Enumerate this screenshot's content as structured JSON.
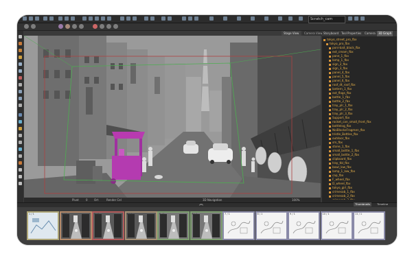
{
  "camera_select": "Scratch_cam",
  "viewport_tabs": [
    "Stage View",
    "Camera View"
  ],
  "right_tabs": [
    "Storyboard",
    "Tool Properties",
    "Camera",
    "3D Graph"
  ],
  "right_active_tab": "3D Graph",
  "scene_tree": [
    "tokyo_street_pro_fbx",
    "tokyo_pro_fbx",
    "poni-bait_black_fbx",
    "ext_cream_fbx",
    "pane_1_fbx",
    "lamp_1_fbx",
    "sign_2_fbx",
    "sign_3_fbx",
    "panel_4_fbx",
    "panel_5_fbx",
    "panel_6_fbx",
    "roof_dt_roof_fbx",
    "lantern_1_fbx",
    "ext_flags_fbx",
    "bottle_1_fbx",
    "bottle_2_fbx",
    "tray_plr_1_fbx",
    "tray_plr_2_fbx",
    "tray_plr_3_fbx",
    "Support_fbx",
    "rocket_can_small_front_fbx",
    "bottlelog_fbx",
    "NoiBlocksFragmen_fbx",
    "tristle_Bottles_fbx",
    "outdoor_fbx",
    "sm_fbx",
    "stone_1_fbx",
    "small_bottle_1_fbx",
    "small_bottle_2_fbx",
    "clipboard_fbx",
    "tray_tbl_fbx",
    "bowl_low_fbx",
    "lamp_1_low_fbx",
    "cap_fbx",
    "F_wheel_fbx",
    "D_wheel_fbx",
    "tokyo_girl_fbx",
    "crimesab_1_fbx",
    "crimesab_2_fbx",
    "crimesab_3_fbx",
    "crimesab_4_fbx",
    "crimesab_5_fbx",
    "Camera_fbx",
    "spot_fbx",
    "Scratch_Cam_fbx"
  ],
  "scene_tree_selected": "Camera_fbx",
  "status_bar": [
    "Pivot",
    "0",
    "Ort",
    "Render Cel",
    "3D Navigation",
    "100%"
  ],
  "bottom_tabs": [
    "Thumbnails",
    "Timeline"
  ],
  "bottom_active_tab": "Thumbnails",
  "thumbnails": [
    {
      "label": "1 / 1",
      "frame": "#b0a878",
      "kind": "sketch-blue"
    },
    {
      "label": "2 / 1",
      "frame": "#b48a6a",
      "kind": "street"
    },
    {
      "label": "3 / 1",
      "frame": "#b45c5c",
      "kind": "street"
    },
    {
      "label": "4 / 1",
      "frame": "#a89276",
      "kind": "street"
    },
    {
      "label": "5 / 1",
      "frame": "#7ea070",
      "kind": "street-bw"
    },
    {
      "label": "6 / 1",
      "frame": "#7ea070",
      "kind": "street-bw"
    },
    {
      "label": "7 / 1",
      "frame": "#8a8aa8",
      "kind": "sketch"
    },
    {
      "label": "8 / 1",
      "frame": "#8a8aa8",
      "kind": "sketch"
    },
    {
      "label": "9 / 1",
      "frame": "#8a8aa8",
      "kind": "sketch"
    },
    {
      "label": "10 / 1",
      "frame": "#8a8aa8",
      "kind": "sketch"
    },
    {
      "label": "11 / 1",
      "frame": "#8a8aa8",
      "kind": "sketch"
    }
  ]
}
